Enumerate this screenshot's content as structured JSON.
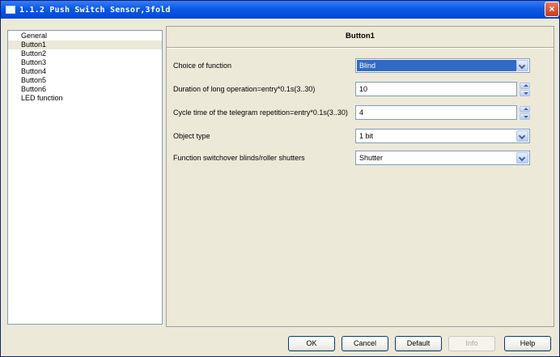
{
  "window": {
    "title": "1.1.2 Push Switch Sensor,3fold",
    "close_label": "×"
  },
  "nav": {
    "items": [
      {
        "label": "General",
        "selected": false
      },
      {
        "label": "Button1",
        "selected": true
      },
      {
        "label": "Button2",
        "selected": false
      },
      {
        "label": "Button3",
        "selected": false
      },
      {
        "label": "Button4",
        "selected": false
      },
      {
        "label": "Button5",
        "selected": false
      },
      {
        "label": "Button6",
        "selected": false
      },
      {
        "label": "LED function",
        "selected": false
      }
    ]
  },
  "panel": {
    "title": "Button1",
    "params": [
      {
        "label": "Choice of function",
        "value": "Blind",
        "control": "dropdown"
      },
      {
        "label": "Duration of long operation=entry*0.1s(3..30)",
        "value": "10",
        "control": "spinner"
      },
      {
        "label": "Cycle time of the telegram repetition=entry*0.1s(3..30)",
        "value": "4",
        "control": "spinner"
      },
      {
        "label": "Object type",
        "value": "1 bit",
        "control": "dropdown"
      },
      {
        "label": "Function switchover blinds/roller shutters",
        "value": "Shutter",
        "control": "dropdown"
      }
    ]
  },
  "buttons": {
    "ok": "OK",
    "cancel": "Cancel",
    "default": "Default",
    "info": "Info",
    "help": "Help"
  }
}
